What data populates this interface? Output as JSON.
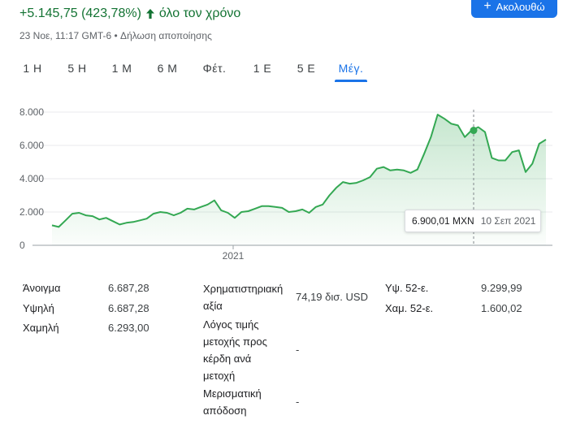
{
  "header": {
    "change_text": "+5.145,75 (423,78%)",
    "period_text": "όλο τον χρόνο",
    "timestamp_text": "23 Νοε, 11:17 GMT-6 • Δήλωση αποποίησης",
    "follow_label": "Ακολουθώ"
  },
  "tabs": [
    {
      "label": "1 Η",
      "active": false
    },
    {
      "label": "5 Η",
      "active": false
    },
    {
      "label": "1 Μ",
      "active": false
    },
    {
      "label": "6 Μ",
      "active": false
    },
    {
      "label": "Φέτ.",
      "active": false
    },
    {
      "label": "1 Ε",
      "active": false
    },
    {
      "label": "5 Ε",
      "active": false
    },
    {
      "label": "Μέγ.",
      "active": true
    }
  ],
  "chart_data": {
    "type": "area",
    "y_ticks": [
      "8.000",
      "6.000",
      "4.000",
      "2.000",
      "0"
    ],
    "y_tick_values": [
      8000,
      6000,
      4000,
      2000,
      0
    ],
    "ylim": [
      0,
      8000
    ],
    "x_tick_label": "2021",
    "color": "#34a853",
    "grid": true,
    "series": [
      {
        "values": [
          1200,
          1100,
          1500,
          1900,
          1950,
          1800,
          1750,
          1550,
          1650,
          1450,
          1250,
          1350,
          1400,
          1500,
          1600,
          1900,
          2000,
          1950,
          1800,
          1950,
          2200,
          2150,
          2300,
          2450,
          2700,
          2100,
          1950,
          1650,
          2000,
          2050,
          2200,
          2350,
          2350,
          2300,
          2250,
          2000,
          2050,
          2150,
          1950,
          2300,
          2450,
          3000,
          3450,
          3800,
          3700,
          3750,
          3900,
          4100,
          4600,
          4700,
          4500,
          4550,
          4500,
          4350,
          4550,
          5500,
          6500,
          7850,
          7600,
          7300,
          7200,
          6500,
          6900,
          7100,
          6800,
          5250,
          5100,
          5100,
          5600,
          5700,
          4400,
          4900,
          6100,
          6350
        ]
      }
    ],
    "highlight": {
      "value": 6900,
      "price_label": "6.900,01 MXN",
      "date_label": "10 Σεπ 2021"
    }
  },
  "stats": {
    "open_label": "Άνοιγμα",
    "open_value": "6.687,28",
    "high_label": "Υψηλή",
    "high_value": "6.687,28",
    "low_label": "Χαμηλή",
    "low_value": "6.293,00",
    "mkt_cap_label_1": "Χρηματιστηριακή",
    "mkt_cap_label_2": "αξία",
    "mkt_cap_value": "74,19 δισ. USD",
    "pe_label_1": "Λόγος τιμής",
    "pe_label_2": "μετοχής προς",
    "pe_label_3": "κέρδη ανά",
    "pe_label_4": "μετοχή",
    "pe_value": "-",
    "div_label_1": "Μερισματική",
    "div_label_2": "απόδοση",
    "div_value": "-",
    "w52_high_label": "Υψ. 52-ε.",
    "w52_high_value": "9.299,99",
    "w52_low_label": "Χαμ. 52-ε.",
    "w52_low_value": "1.600,02"
  }
}
